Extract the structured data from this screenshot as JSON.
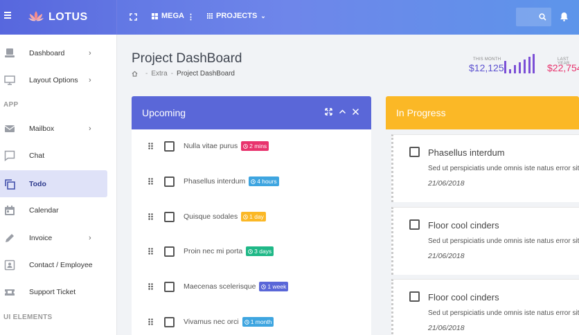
{
  "brand": {
    "name": "LOTUS"
  },
  "topbar": {
    "mega_label": "MEGA",
    "projects_label": "PROJECTS"
  },
  "sidebar": {
    "items": [
      {
        "label": "Dashboard",
        "icon": "monitor-icon",
        "has_submenu": true
      },
      {
        "label": "Layout Options",
        "icon": "desktop-icon",
        "has_submenu": true
      },
      {
        "label": "Mailbox",
        "icon": "envelope-icon",
        "has_submenu": true
      },
      {
        "label": "Chat",
        "icon": "chat-bubble-icon",
        "has_submenu": false
      },
      {
        "label": "Todo",
        "icon": "copy-icon",
        "has_submenu": false,
        "active": true
      },
      {
        "label": "Calendar",
        "icon": "calendar-icon",
        "has_submenu": false
      },
      {
        "label": "Invoice",
        "icon": "pencil-icon",
        "has_submenu": true
      },
      {
        "label": "Contact / Employee",
        "icon": "contact-card-icon",
        "has_submenu": false
      },
      {
        "label": "Support Ticket",
        "icon": "ticket-icon",
        "has_submenu": false
      }
    ],
    "section_app": "APP",
    "section_ui": "UI ELEMENTS"
  },
  "page": {
    "title": "Project DashBoard",
    "breadcrumb": [
      "Extra",
      "Project DashBoard"
    ]
  },
  "stats": [
    {
      "label": "THIS MONTH",
      "value": "$12,125",
      "color": "#5a4fcf"
    },
    {
      "label": "LAST YEAR",
      "value": "$22,754",
      "color": "#e8336d"
    }
  ],
  "upcoming": {
    "title": "Upcoming",
    "color": "#5a67d8",
    "items": [
      {
        "text": "Nulla vitae purus",
        "badge": "2 mins",
        "badge_color": "#e8336d"
      },
      {
        "text": "Phasellus interdum",
        "badge": "4 hours",
        "badge_color": "#3ea5e0"
      },
      {
        "text": "Quisque sodales",
        "badge": "1 day",
        "badge_color": "#fbb826"
      },
      {
        "text": "Proin nec mi porta",
        "badge": "3 days",
        "badge_color": "#1fb887"
      },
      {
        "text": "Maecenas scelerisque",
        "badge": "1 week",
        "badge_color": "#5a67d8"
      },
      {
        "text": "Vivamus nec orci",
        "badge": "1 month",
        "badge_color": "#3ea5e0"
      }
    ]
  },
  "in_progress": {
    "title": "In Progress",
    "color": "#fbb826",
    "items": [
      {
        "title": "Phasellus interdum",
        "desc": "Sed ut perspiciatis unde omnis iste natus error sit.",
        "date": "21/06/2018"
      },
      {
        "title": "Floor cool cinders",
        "desc": "Sed ut perspiciatis unde omnis iste natus error sit.",
        "date": "21/06/2018"
      },
      {
        "title": "Floor cool cinders",
        "desc": "Sed ut perspiciatis unde omnis iste natus error sit.",
        "date": "21/06/2018"
      }
    ]
  }
}
